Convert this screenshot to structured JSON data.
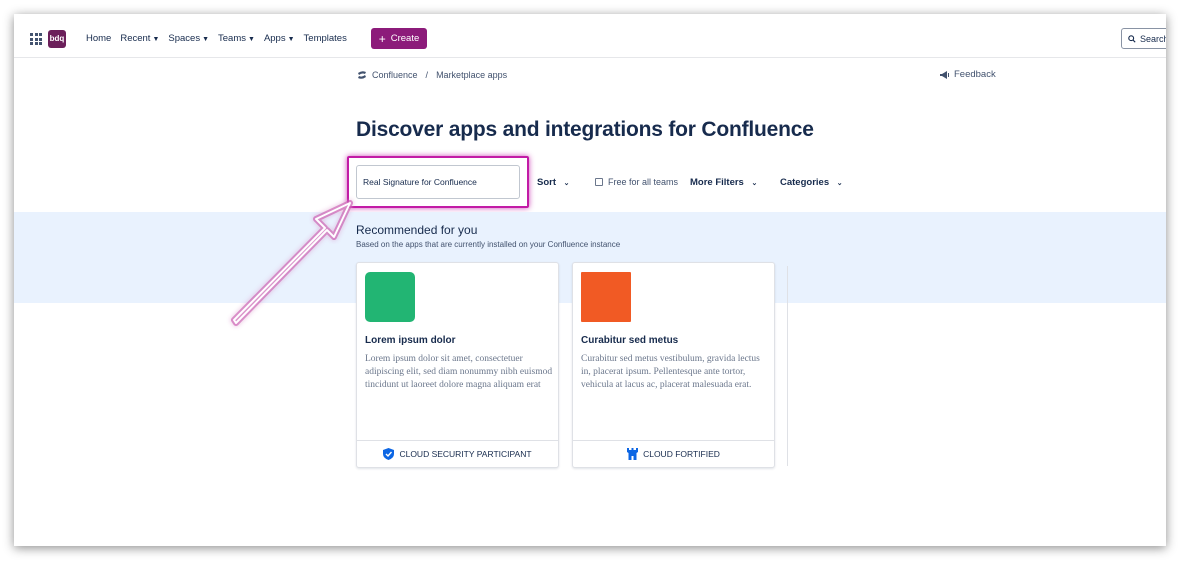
{
  "nav": {
    "logo_text": "bdq",
    "items": [
      {
        "label": "Home",
        "caret": false
      },
      {
        "label": "Recent",
        "caret": true
      },
      {
        "label": "Spaces",
        "caret": true
      },
      {
        "label": "Teams",
        "caret": true
      },
      {
        "label": "Apps",
        "caret": true
      },
      {
        "label": "Templates",
        "caret": false
      }
    ],
    "create_label": "Create",
    "search_placeholder": "Search"
  },
  "breadcrumb": {
    "root": "Confluence",
    "separator": "/",
    "current": "Marketplace apps"
  },
  "feedback_label": "Feedback",
  "page_title": "Discover apps and integrations for Confluence",
  "filters": {
    "search_value": "Real Signature for Confluence",
    "sort_label": "Sort",
    "free_label": "Free for all teams",
    "more_filters_label": "More Filters",
    "categories_label": "Categories"
  },
  "recommended": {
    "title": "Recommended for you",
    "subtitle": "Based on the apps that are currently installed on your Confluence instance",
    "cards": [
      {
        "title": "Lorem ipsum dolor",
        "description": "Lorem ipsum dolor sit amet, consectetuer adipiscing elit, sed diam nonummy nibh euismod tincidunt ut laoreet dolore magna aliquam erat",
        "badge": "CLOUD SECURITY PARTICIPANT",
        "badge_icon": "shield-check-icon",
        "color": "#22b573"
      },
      {
        "title": "Curabitur sed metus",
        "description": "Curabitur sed metus vestibulum, gravida lectus in, placerat ipsum. Pellentesque ante tortor, vehicula at lacus ac, placerat malesuada erat.",
        "badge": "CLOUD FORTIFIED",
        "badge_icon": "castle-icon",
        "color": "#f15a24"
      }
    ]
  },
  "colors": {
    "accent": "#8c1b7a",
    "highlight": "#c21ba6",
    "band": "#e9f2fe",
    "badge_blue": "#0c66e4"
  }
}
